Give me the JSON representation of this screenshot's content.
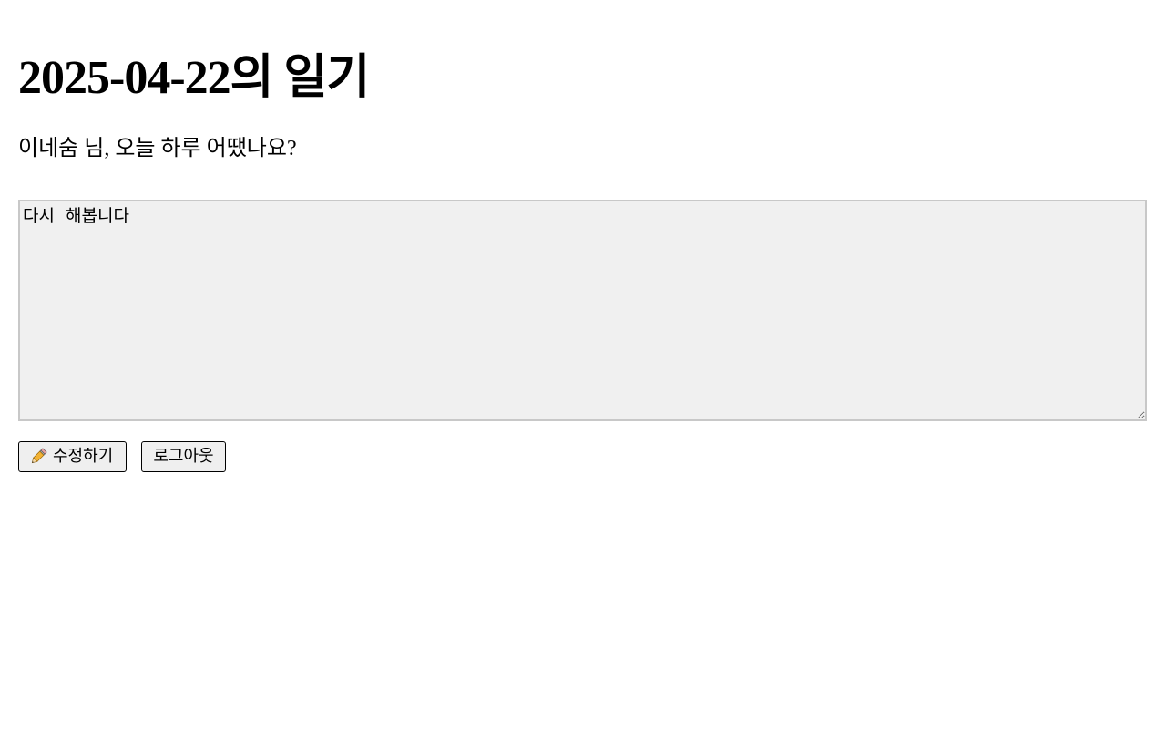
{
  "page": {
    "title": "2025-04-22의 일기",
    "greeting": "이네숨 님, 오늘 하루 어땠나요?"
  },
  "diary": {
    "content": "다시  해봅니다"
  },
  "actions": {
    "edit_label": "수정하기",
    "edit_icon": "pencil-icon",
    "logout_label": "로그아웃"
  },
  "colors": {
    "textarea_bg": "#f0f0f0",
    "textarea_border": "#c8c8c8",
    "button_bg": "#efefef"
  }
}
